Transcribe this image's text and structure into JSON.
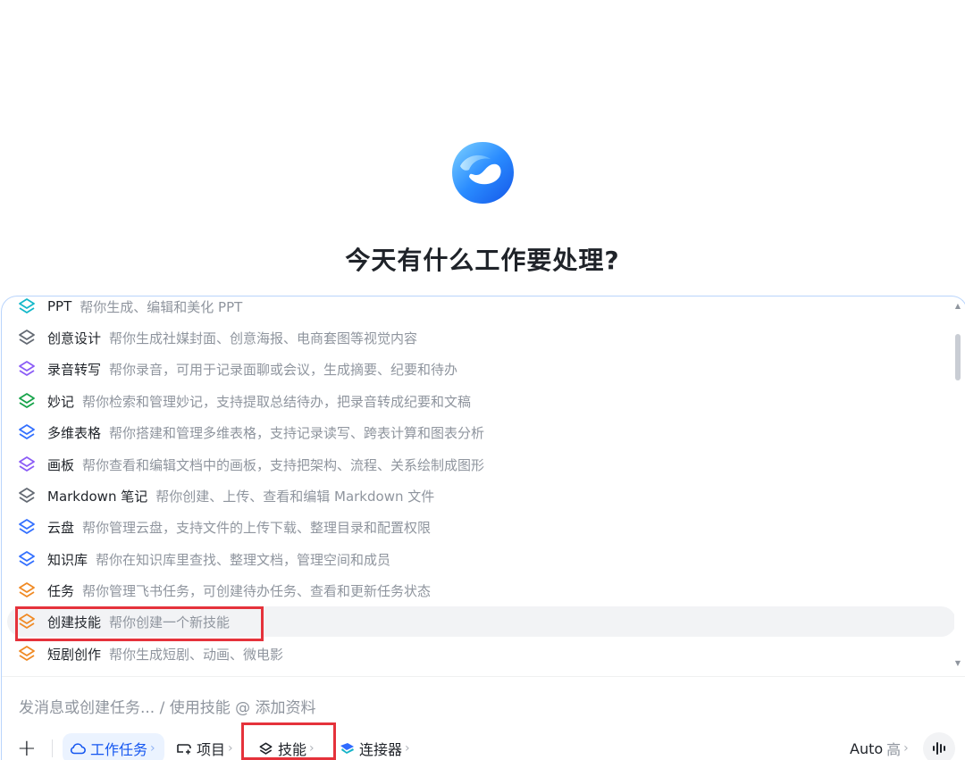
{
  "heading": "今天有什么工作要处理?",
  "skills": [
    {
      "name": "PPT",
      "desc": "帮你生成、编辑和美化 PPT",
      "color": "#14b8c9",
      "partial": true
    },
    {
      "name": "创意设计",
      "desc": "帮你生成社媒封面、创意海报、电商套图等视觉内容",
      "color": "#646a73"
    },
    {
      "name": "录音转写",
      "desc": "帮你录音，可用于记录面聊或会议，生成摘要、纪要和待办",
      "color": "#8b5cf6"
    },
    {
      "name": "妙记",
      "desc": "帮你检索和管理妙记，支持提取总结待办，把录音转成纪要和文稿",
      "color": "#16a34a"
    },
    {
      "name": "多维表格",
      "desc": "帮你搭建和管理多维表格，支持记录读写、跨表计算和图表分析",
      "color": "#3370ff"
    },
    {
      "name": "画板",
      "desc": "帮你查看和编辑文档中的画板，支持把架构、流程、关系绘制成图形",
      "color": "#8b5cf6"
    },
    {
      "name": "Markdown 笔记",
      "desc": "帮你创建、上传、查看和编辑 Markdown 文件",
      "color": "#646a73"
    },
    {
      "name": "云盘",
      "desc": "帮你管理云盘，支持文件的上传下载、整理目录和配置权限",
      "color": "#3370ff"
    },
    {
      "name": "知识库",
      "desc": "帮你在知识库里查找、整理文档，管理空间和成员",
      "color": "#3370ff"
    },
    {
      "name": "任务",
      "desc": "帮你管理飞书任务，可创建待办任务、查看和更新任务状态",
      "color": "#f08a24"
    },
    {
      "name": "创建技能",
      "desc": "帮你创建一个新技能",
      "color": "#f08a24",
      "active": true
    },
    {
      "name": "短剧创作",
      "desc": "帮你生成短剧、动画、微电影",
      "color": "#f08a24"
    }
  ],
  "input": {
    "placeholder": "发消息或创建任务... / 使用技能 @ 添加资料"
  },
  "toolbar": {
    "work_task": "工作任务",
    "project": "项目",
    "skills": "技能",
    "connector": "连接器",
    "mode": "Auto",
    "level": "高"
  },
  "icons": {
    "logo": "app-logo",
    "skill": "layers-icon",
    "add": "plus-icon",
    "cloud": "cloud-icon",
    "project": "project-icon",
    "connector": "connector-icon",
    "voice": "voice-wave-icon"
  },
  "colors": {
    "accent": "#1456f0",
    "highlight": "#e5323b"
  }
}
